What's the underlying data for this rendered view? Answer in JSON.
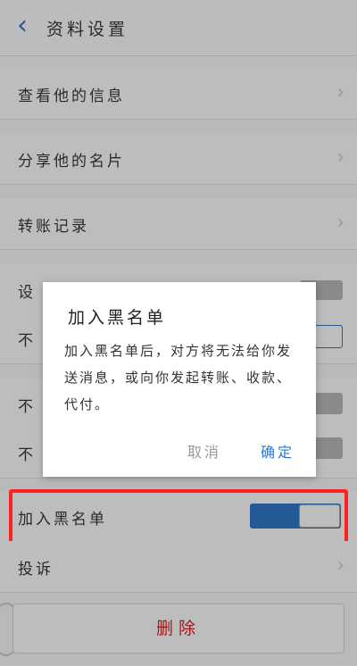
{
  "header": {
    "back_icon": "chevron-left-icon",
    "title": "资料设置"
  },
  "rows": {
    "view_info": "查看他的信息",
    "share_card": "分享他的名片",
    "transfer_record": "转账记录",
    "setting_a": "设",
    "setting_b": "不",
    "setting_c": "不",
    "setting_d": "不",
    "blacklist": "加入黑名单",
    "report": "投诉"
  },
  "blacklist_toggle": {
    "on": true
  },
  "delete_button": "删除",
  "dialog": {
    "title": "加入黑名单",
    "message": "加入黑名单后，对方将无法给你发送消息，或向你发起转账、收款、代付。",
    "cancel": "取消",
    "confirm": "确定"
  },
  "colors": {
    "accent": "#245a96",
    "confirm": "#2b78d0",
    "delete": "#a21818",
    "highlight": "#ff2020"
  }
}
